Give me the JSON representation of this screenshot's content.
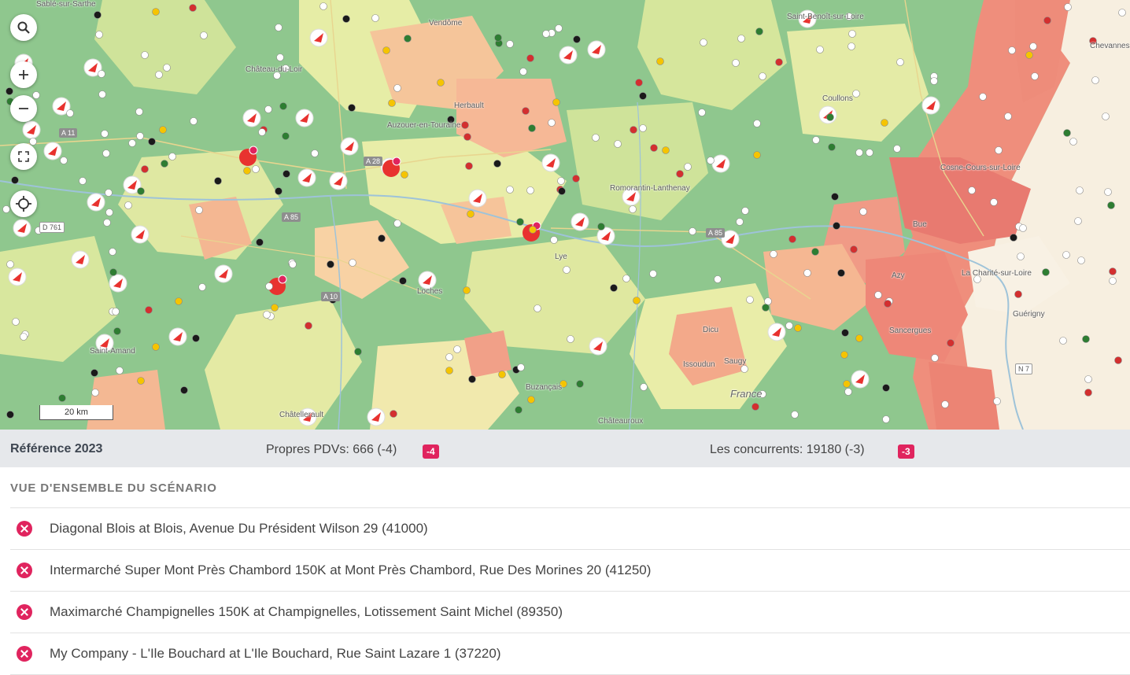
{
  "map": {
    "scale_label": "20 km",
    "places": [
      "Sablé-sur-Sarthe",
      "Vendôme",
      "Saint-Benoît-sur-Loire",
      "Château-du-Loir",
      "Herbault",
      "Auzouer-en-Touraine",
      "Coullons",
      "Romorantin-Lanthenay",
      "Chevannes",
      "Cosne-Cours-sur-Loire",
      "Lye",
      "Loches",
      "Azy",
      "La Charité-sur-Loire",
      "Guérigny",
      "Sancergues",
      "Dicu",
      "Issoudun",
      "Saugy",
      "Buzançais",
      "Châteauroux",
      "Châtellerault",
      "France",
      "Bue",
      "Saint-Amand"
    ],
    "roads": [
      "A 11",
      "A 28",
      "A 85",
      "D 761",
      "A 10",
      "A 85",
      "N 7"
    ]
  },
  "summary": {
    "reference": "Référence 2023",
    "own_pdvs": "Propres PDVs: 666 (-4)",
    "own_delta": "-4",
    "competitors": "Les concurrents: 19180 (-3)",
    "competitors_delta": "-3"
  },
  "overview": {
    "title": "VUE D'ENSEMBLE DU SCÉNARIO",
    "items": [
      {
        "label": "Diagonal Blois at Blois, Avenue Du Président Wilson 29 (41000)"
      },
      {
        "label": "Intermarché Super Mont Près Chambord 150K at Mont Près Chambord, Rue Des Morines 20 (41250)"
      },
      {
        "label": "Maximarché Champignelles 150K at Champignelles, Lotissement Saint Michel (89350)"
      },
      {
        "label": "My Company - L'Ile Bouchard at L'Ile Bouchard, Rue Saint Lazare 1 (37220)"
      }
    ]
  }
}
